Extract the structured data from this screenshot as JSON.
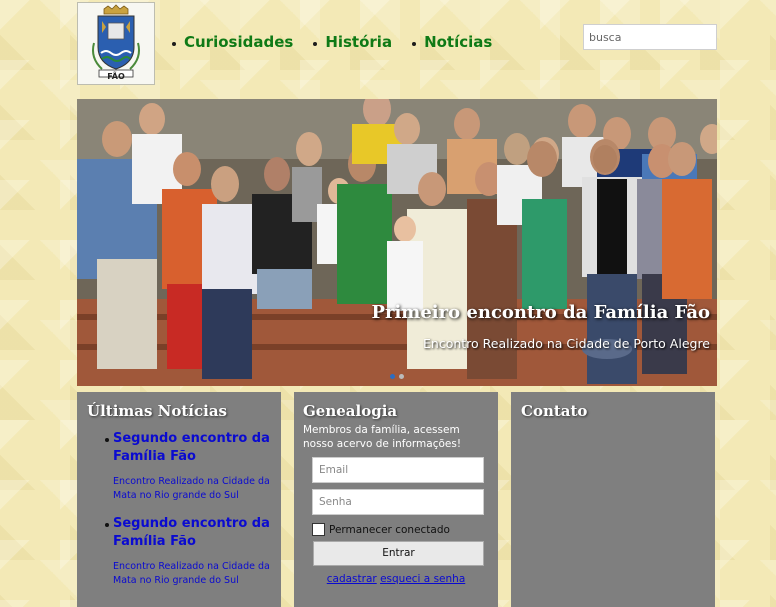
{
  "logo": {
    "text": "FÃO"
  },
  "nav": {
    "items": [
      "Curiosidades",
      "História",
      "Notícias"
    ]
  },
  "search": {
    "placeholder": "busca"
  },
  "banner": {
    "title": "Primeiro encontro da Família Fão",
    "subtitle": "Encontro Realizado na Cidade de Porto Alegre"
  },
  "news": {
    "heading": "Últimas Notícias",
    "items": [
      {
        "title": "Segundo encontro da Família Fão",
        "description": "Encontro Realizado na Cidade da Mata no Rio grande do Sul"
      },
      {
        "title": "Segundo encontro da Família Fão",
        "description": "Encontro Realizado na Cidade da Mata no Rio grande do Sul"
      }
    ]
  },
  "genealogy": {
    "heading": "Genealogia",
    "text": "Membros da família, acessem nosso acervo de informações!",
    "email_placeholder": "Email",
    "password_placeholder": "Senha",
    "remember_label": "Permanecer conectado",
    "submit_label": "Entrar",
    "register_link": "cadastrar",
    "forgot_link": "esqueci a senha"
  },
  "contact": {
    "heading": "Contato"
  },
  "colors": {
    "nav": "#0f7a16",
    "link": "#0a0ad0",
    "panel": "#7f7f7f",
    "background": "#f3e9b6"
  }
}
